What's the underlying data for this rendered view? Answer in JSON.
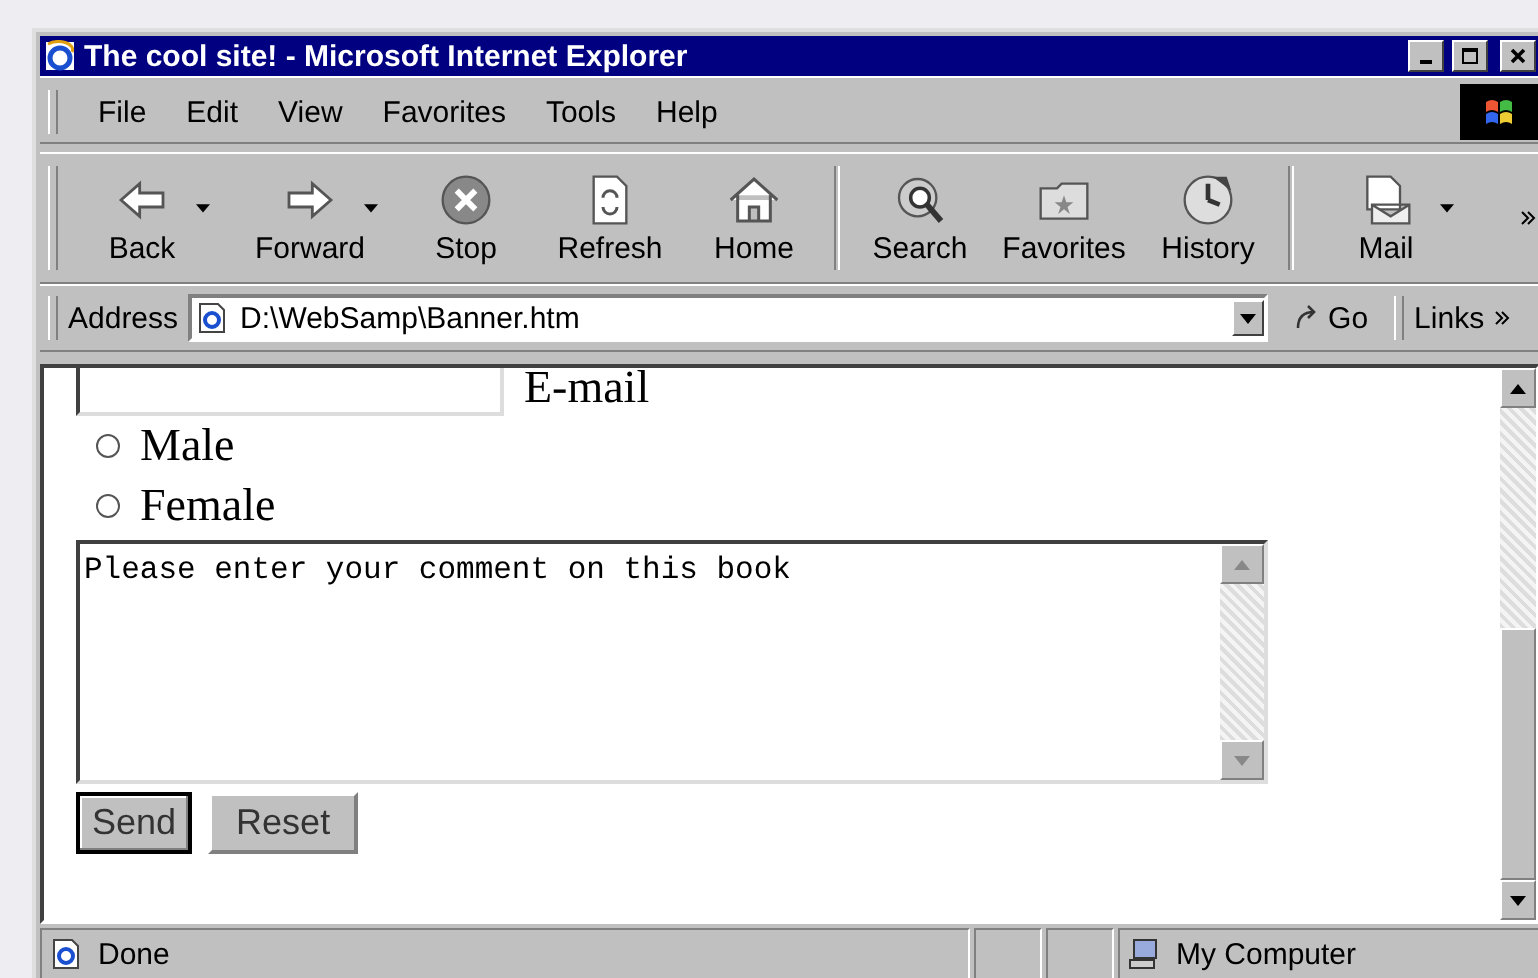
{
  "window": {
    "title": "The cool site! - Microsoft Internet Explorer"
  },
  "menu": [
    {
      "label": "File"
    },
    {
      "label": "Edit"
    },
    {
      "label": "View"
    },
    {
      "label": "Favorites"
    },
    {
      "label": "Tools"
    },
    {
      "label": "Help"
    }
  ],
  "toolbar": [
    {
      "kind": "back",
      "label": "Back",
      "dropdown": true,
      "group_end": false
    },
    {
      "kind": "forward",
      "label": "Forward",
      "dropdown": true,
      "group_end": false
    },
    {
      "kind": "stop",
      "label": "Stop",
      "dropdown": false,
      "group_end": false
    },
    {
      "kind": "refresh",
      "label": "Refresh",
      "dropdown": false,
      "group_end": false
    },
    {
      "kind": "home",
      "label": "Home",
      "dropdown": false,
      "group_end": true
    },
    {
      "kind": "search",
      "label": "Search",
      "dropdown": false,
      "group_end": false
    },
    {
      "kind": "favorites",
      "label": "Favorites",
      "dropdown": false,
      "group_end": false
    },
    {
      "kind": "history",
      "label": "History",
      "dropdown": false,
      "group_end": true
    },
    {
      "kind": "mail",
      "label": "Mail",
      "dropdown": true,
      "group_end": false
    }
  ],
  "address": {
    "label": "Address",
    "value": "D:\\WebSamp\\Banner.htm",
    "go": "Go",
    "links": "Links"
  },
  "form": {
    "email": {
      "label": "E-mail"
    },
    "radios": [
      {
        "label": "Male",
        "selected": false
      },
      {
        "label": "Female",
        "selected": false
      }
    ],
    "comment": {
      "value": "Please enter your comment on this book"
    },
    "buttons": [
      {
        "label": "Send",
        "focused": true
      },
      {
        "label": "Reset",
        "focused": false
      }
    ]
  },
  "status_bar": {
    "text": "Done",
    "zone": "My Computer"
  }
}
